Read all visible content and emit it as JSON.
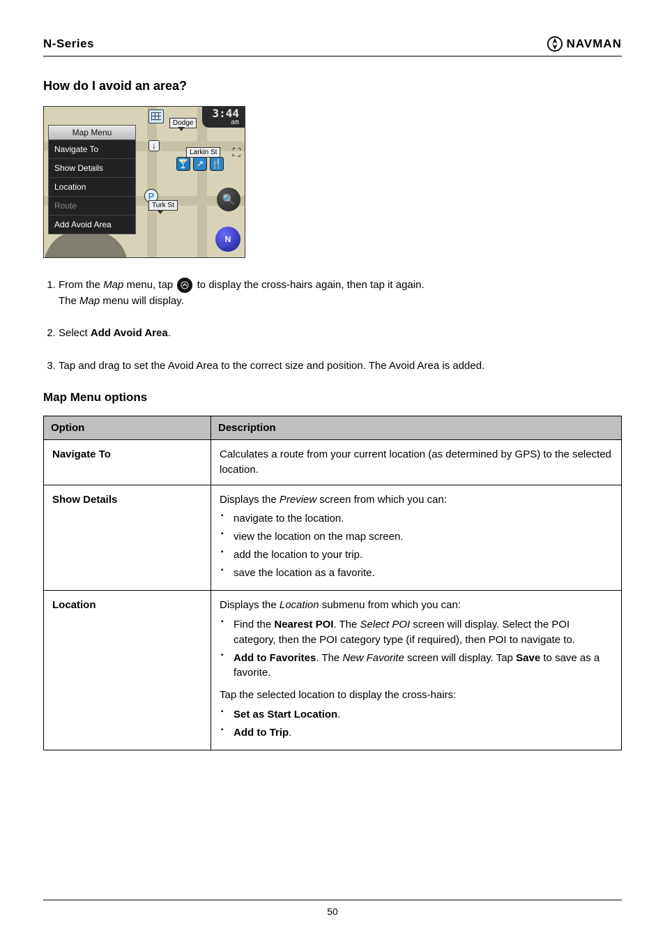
{
  "header": {
    "series": "N-Series",
    "brand": "NAVMAN"
  },
  "section_title": "How do I avoid an area?",
  "map": {
    "clock_time": "3:44",
    "clock_ampm": "am",
    "menu_header": "Map Menu",
    "menu_items": {
      "navigate_to": "Navigate To",
      "show_details": "Show Details",
      "location": "Location",
      "route": "Route",
      "add_avoid_area": "Add Avoid Area"
    },
    "labels": {
      "dodge": "Dodge",
      "larkin": "Larkin St",
      "turk": "Turk St"
    },
    "compass": "N"
  },
  "instructions": {
    "step1_pre": "From the ",
    "step1_italic": "Map",
    "step1_mid": " menu, tap ",
    "step1_after": " to display the cross-hairs again, then tap it again.",
    "step1_result_pre": "The ",
    "step1_result_italic": "Map",
    "step1_result_post": " menu will display.",
    "step2_pre": "Select ",
    "step2_bold": "Add Avoid Area",
    "step2_post": ".",
    "step3": "Tap and drag to set the Avoid Area to the correct size and position. The Avoid Area is added."
  },
  "sub_title": "Map Menu options",
  "table": {
    "header_option": "Option",
    "header_desc": "Description",
    "rows": {
      "navigate_to": {
        "name": "Navigate To",
        "desc": "Calculates a route from your current location (as determined by GPS) to the selected location."
      },
      "show_details": {
        "name": "Show Details",
        "intro_pre": "Displays the ",
        "intro_italic": "Preview",
        "intro_post": " screen from which you can:",
        "items": {
          "a": "navigate to the location.",
          "b": "view the location on the map screen.",
          "c": "add the location to your trip.",
          "d": "save the location as a favorite."
        }
      },
      "location": {
        "name": "Location",
        "intro_pre": "Displays the ",
        "intro_italic": "Location",
        "intro_post": " submenu from which you can:",
        "items": {
          "a_pre": "Find the ",
          "a_bold": "Nearest POI",
          "a_post_pre": ". The ",
          "a_post_italic": "Select POI",
          "a_post_end": " screen will display. Select the POI category, then the POI category type (if required), then POI to navigate to.",
          "b_bold": "Add to Favorites",
          "b_post_pre": ". The ",
          "b_post_italic": "New Favorite",
          "b_post_end_pre": " screen will display. Tap ",
          "b_post_bold2": "Save",
          "b_post_end": " to save as a favorite.",
          "c_bold": "Set as Start Location",
          "c_post": ".",
          "d_bold": "Add to Trip",
          "d_post": "."
        },
        "footer": "Tap the selected location to display the cross-hairs:"
      }
    }
  },
  "footer_page": "50"
}
